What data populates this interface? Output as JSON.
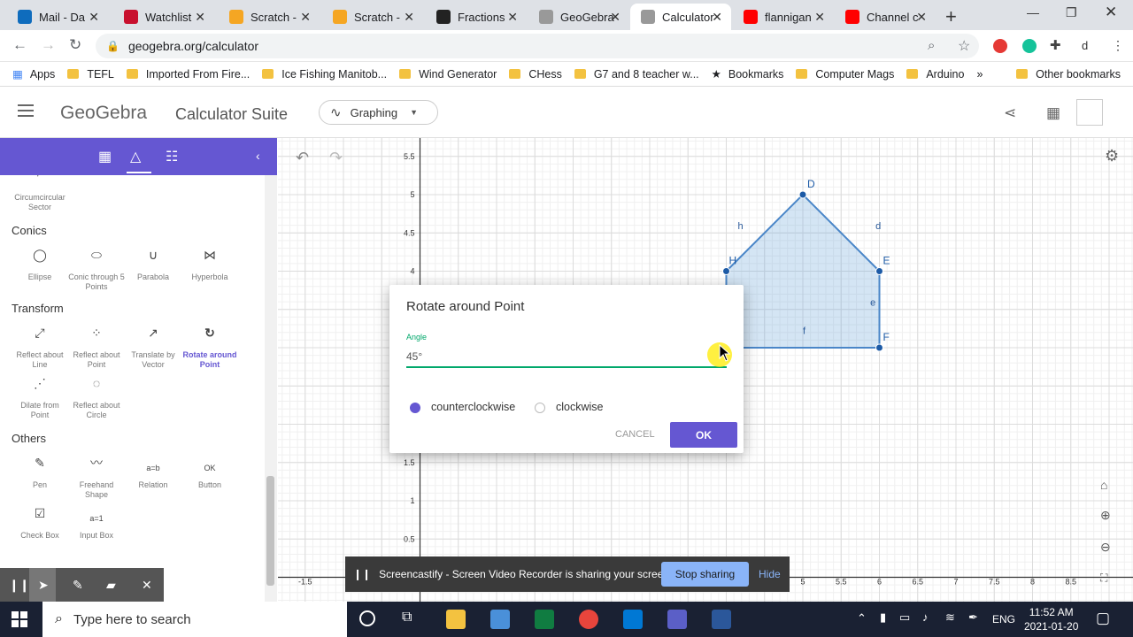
{
  "browser": {
    "tabs": [
      {
        "title": "Mail - Da",
        "color": "#0f6cbd"
      },
      {
        "title": "Watchlist",
        "color": "#c8102e"
      },
      {
        "title": "Scratch - ",
        "color": "#f5a623"
      },
      {
        "title": "Scratch - ",
        "color": "#f5a623"
      },
      {
        "title": "Fractions",
        "color": "#222222"
      },
      {
        "title": "GeoGebra",
        "color": "#999999"
      },
      {
        "title": "Calculator",
        "color": "#999999"
      },
      {
        "title": "flannigan",
        "color": "#ff0000"
      },
      {
        "title": "Channel c",
        "color": "#ff0000"
      }
    ],
    "url": "geogebra.org/calculator",
    "bookmarks": [
      "Apps",
      "TEFL",
      "Imported From Fire...",
      "Ice Fishing Manitob...",
      "Wind Generator",
      "CHess",
      "G7 and 8 teacher w...",
      "Bookmarks",
      "Computer Mags",
      "Arduino",
      "»",
      "Other bookmarks"
    ],
    "profile_initial": "d"
  },
  "app": {
    "logo": "GeoGebra",
    "suite": "Calculator Suite",
    "app_selector": "Graphing"
  },
  "toolbox": {
    "groups": [
      {
        "title": "",
        "tools": [
          {
            "label": "Circumcircular Sector",
            "icon": "circumcircular-sector-icon"
          }
        ]
      },
      {
        "title": "Conics",
        "tools": [
          {
            "label": "Ellipse",
            "icon": "ellipse-icon"
          },
          {
            "label": "Conic through 5 Points",
            "icon": "conic-icon"
          },
          {
            "label": "Parabola",
            "icon": "parabola-icon"
          },
          {
            "label": "Hyperbola",
            "icon": "hyperbola-icon"
          }
        ]
      },
      {
        "title": "Transform",
        "tools": [
          {
            "label": "Reflect about Line",
            "icon": "reflect-line-icon"
          },
          {
            "label": "Reflect about Point",
            "icon": "reflect-point-icon"
          },
          {
            "label": "Translate by Vector",
            "icon": "translate-icon"
          },
          {
            "label": "Rotate around Point",
            "icon": "rotate-icon",
            "selected": true
          },
          {
            "label": "Dilate from Point",
            "icon": "dilate-icon"
          },
          {
            "label": "Reflect about Circle",
            "icon": "reflect-circle-icon"
          }
        ]
      },
      {
        "title": "Others",
        "tools": [
          {
            "label": "Pen",
            "icon": "pen-icon"
          },
          {
            "label": "Freehand Shape",
            "icon": "freehand-icon"
          },
          {
            "label": "Relation",
            "icon": "relation-icon"
          },
          {
            "label": "Button",
            "icon": "button-icon"
          },
          {
            "label": "Check Box",
            "icon": "checkbox-icon"
          },
          {
            "label": "Input Box",
            "icon": "inputbox-icon"
          }
        ]
      }
    ],
    "relation_icon_text": "a=b",
    "button_icon_text": "OK",
    "inputbox_icon_text": "a=1"
  },
  "graph": {
    "x_ticks": [
      "-1.5",
      "5",
      "5.5",
      "6",
      "6.5",
      "7",
      "7.5",
      "8",
      "8.5"
    ],
    "y_ticks": [
      "5.5",
      "5",
      "4.5",
      "4",
      "1.5",
      "1",
      "0.5"
    ],
    "points": [
      {
        "name": "D",
        "x": 5,
        "y": 5
      },
      {
        "name": "E",
        "x": 6,
        "y": 4
      },
      {
        "name": "F",
        "x": 6,
        "y": 3
      },
      {
        "name": "H",
        "x": 4,
        "y": 4
      }
    ],
    "segment_labels": [
      "h",
      "d",
      "e",
      "f"
    ],
    "polygon_color": "#6fa8dc"
  },
  "dialog": {
    "title": "Rotate around Point",
    "angle_label": "Angle",
    "angle_value": "45°",
    "options": [
      "counterclockwise",
      "clockwise"
    ],
    "selected_option": "counterclockwise",
    "cancel": "CANCEL",
    "ok": "OK"
  },
  "screencast": {
    "message": "Screencastify - Screen Video Recorder is sharing your screen.",
    "stop": "Stop sharing",
    "hide": "Hide"
  },
  "taskbar": {
    "search_placeholder": "Type here to search",
    "language": "ENG",
    "time": "11:52 AM",
    "date": "2021-01-20"
  }
}
